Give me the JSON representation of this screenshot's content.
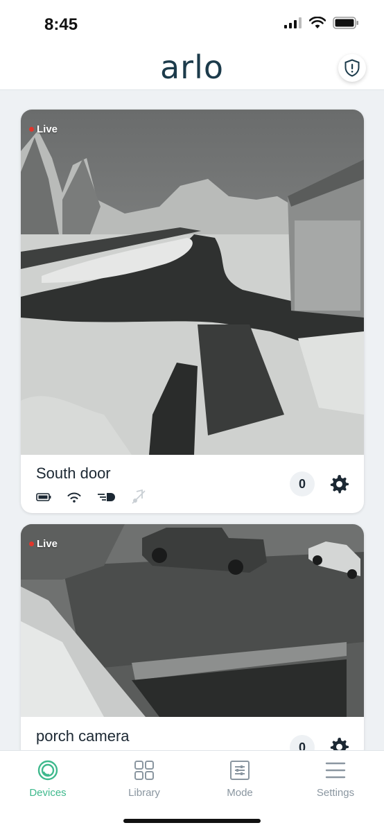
{
  "status_bar": {
    "time": "8:45"
  },
  "header": {
    "logo": "arlo"
  },
  "devices": [
    {
      "live_label": "Live",
      "name": "South door",
      "count": "0"
    },
    {
      "live_label": "Live",
      "name": "porch camera",
      "count": "0"
    }
  ],
  "bottom_nav": [
    {
      "label": "Devices",
      "icon": "devices-icon",
      "active": true
    },
    {
      "label": "Library",
      "icon": "library-icon",
      "active": false
    },
    {
      "label": "Mode",
      "icon": "mode-icon",
      "active": false
    },
    {
      "label": "Settings",
      "icon": "settings-icon",
      "active": false
    }
  ],
  "colors": {
    "accent": "#3fb98d",
    "logo": "#1c3b4b",
    "live_dot": "#e2352b",
    "background": "#eef1f4"
  }
}
